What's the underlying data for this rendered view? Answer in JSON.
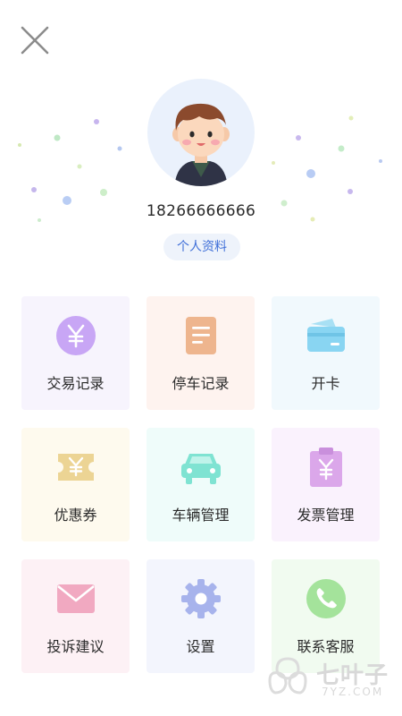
{
  "profile": {
    "phone": "18266666666",
    "profile_button_label": "个人资料"
  },
  "menu": {
    "items": [
      {
        "label": "交易记录",
        "icon": "yuan-coin-icon",
        "bg": "#f7f4fd",
        "color": "#c8a6f5"
      },
      {
        "label": "停车记录",
        "icon": "document-icon",
        "bg": "#fef3ef",
        "color": "#eeb58e"
      },
      {
        "label": "开卡",
        "icon": "card-icon",
        "bg": "#f1f9fd",
        "color": "#89d5f2"
      },
      {
        "label": "优惠券",
        "icon": "coupon-icon",
        "bg": "#fefaee",
        "color": "#ecd494"
      },
      {
        "label": "车辆管理",
        "icon": "car-icon",
        "bg": "#effcfa",
        "color": "#7fe3d2"
      },
      {
        "label": "发票管理",
        "icon": "invoice-icon",
        "bg": "#faf2fd",
        "color": "#dba7ea"
      },
      {
        "label": "投诉建议",
        "icon": "envelope-icon",
        "bg": "#fdf1f5",
        "color": "#f1a9c1"
      },
      {
        "label": "设置",
        "icon": "gear-icon",
        "bg": "#f3f5fd",
        "color": "#a7b3ec"
      },
      {
        "label": "联系客服",
        "icon": "phone-icon",
        "bg": "#f1fbf0",
        "color": "#a4e39b"
      }
    ]
  },
  "watermark": {
    "main": "七叶子",
    "sub": "7YZ.COM"
  }
}
